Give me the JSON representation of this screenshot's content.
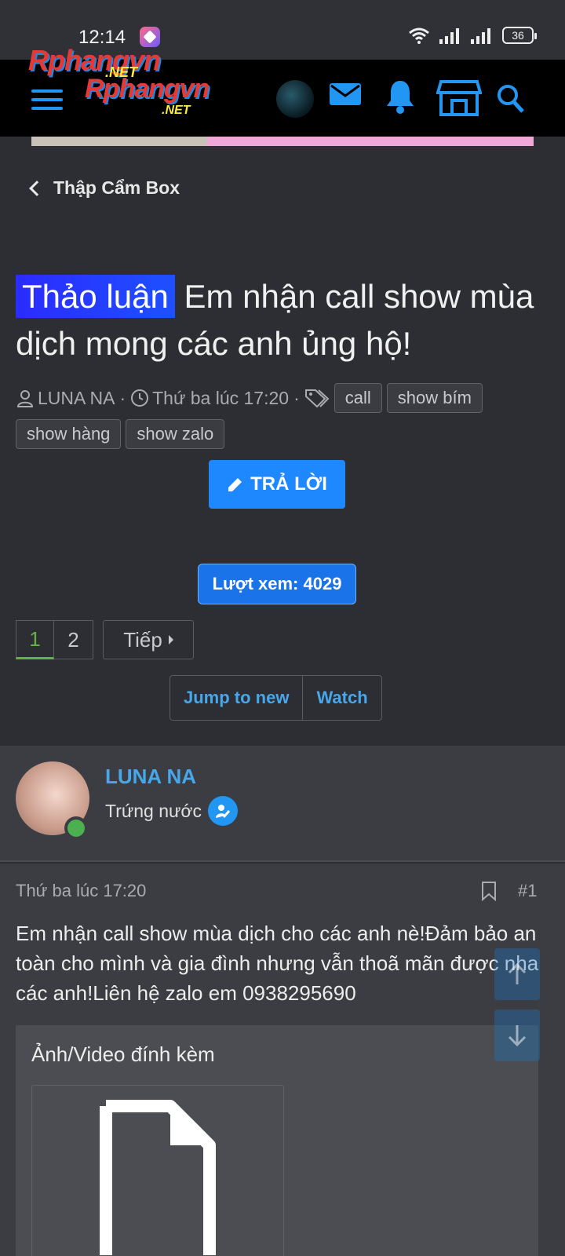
{
  "status_bar": {
    "time": "12:14",
    "battery": "36"
  },
  "header": {
    "logo_line1": "Rphangvn",
    "logo_net1": ".NET",
    "logo_line2": "Rphangvn",
    "logo_net2": ".NET"
  },
  "breadcrumb": {
    "label": "Thập Cẩm Box"
  },
  "thread": {
    "prefix": "Thảo luận",
    "title": "Em nhận call show mùa dịch mong các anh ủng hộ!",
    "author": "LUNA NA",
    "date": "Thứ ba lúc 17:20",
    "tags": [
      "call",
      "show bím",
      "show hàng",
      "show zalo"
    ]
  },
  "reply_button": {
    "label": "TRẢ LỜI"
  },
  "views": {
    "label": "Lượt xem: 4029"
  },
  "pagination": {
    "pages": [
      "1",
      "2"
    ],
    "next_label": "Tiếp"
  },
  "actions": {
    "jump_label": "Jump to new",
    "watch_label": "Watch"
  },
  "post": {
    "username": "LUNA NA",
    "user_title": "Trứng nước",
    "date": "Thứ ba lúc 17:20",
    "number": "#1",
    "text": "Em nhận call show mùa dịch cho các anh nè!Đảm bảo an toàn cho mình và gia đình nhưng vẫn thoã mãn được nha các anh!Liên hệ zalo em 0938295690",
    "attachments_title": "Ảnh/Video đính kèm"
  },
  "colors": {
    "background": "#2c2e33",
    "accent": "#1e88ff",
    "link": "#47a7eb",
    "online": "#4caf50"
  }
}
